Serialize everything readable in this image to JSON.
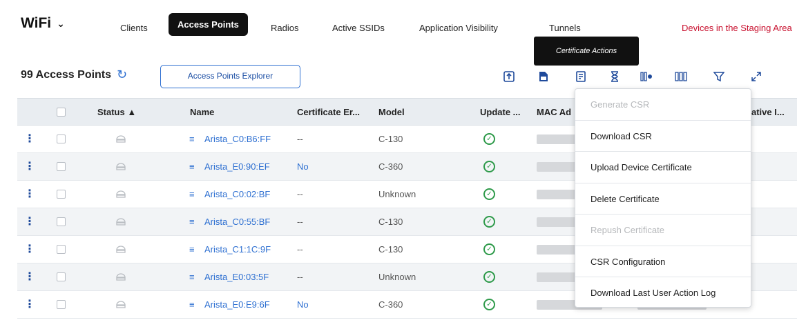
{
  "nav": {
    "app_title": "WiFi",
    "tabs": [
      {
        "label": "Clients"
      },
      {
        "label": "Access Points",
        "active": true
      },
      {
        "label": "Radios"
      },
      {
        "label": "Active SSIDs"
      },
      {
        "label": "Application Visibility"
      },
      {
        "label": "Tunnels"
      }
    ],
    "staging_link": "Devices in the Staging Area"
  },
  "tooltip": "Certificate Actions",
  "toolbar": {
    "count_label": "99 Access Points",
    "explorer_button": "Access Points Explorer",
    "icons": [
      "upload-icon",
      "document-icon",
      "certificate-icon",
      "hourglass-icon",
      "column-settings-icon",
      "columns-icon",
      "filter-icon",
      "expand-icon"
    ]
  },
  "table": {
    "headers": {
      "status": "Status ▲",
      "name": "Name",
      "cert_error": "Certificate Er...",
      "model": "Model",
      "update": "Update ...",
      "mac": "MAC Ad",
      "native": "ative I..."
    },
    "rows": [
      {
        "name": "Arista_C0:B6:FF",
        "cert_error": "--",
        "model": "C-130"
      },
      {
        "name": "Arista_E0:90:EF",
        "cert_error": "No",
        "model": "C-360"
      },
      {
        "name": "Arista_C0:02:BF",
        "cert_error": "--",
        "model": "Unknown"
      },
      {
        "name": "Arista_C0:55:BF",
        "cert_error": "--",
        "model": "C-130"
      },
      {
        "name": "Arista_C1:1C:9F",
        "cert_error": "--",
        "model": "C-130"
      },
      {
        "name": "Arista_E0:03:5F",
        "cert_error": "--",
        "model": "Unknown"
      },
      {
        "name": "Arista_E0:E9:6F",
        "cert_error": "No",
        "model": "C-360",
        "trailing": "--"
      }
    ]
  },
  "menu": {
    "items": [
      {
        "label": "Generate CSR",
        "disabled": true
      },
      {
        "label": "Download CSR",
        "disabled": false
      },
      {
        "label": "Upload Device Certificate",
        "disabled": false
      },
      {
        "label": "Delete Certificate",
        "disabled": false
      },
      {
        "label": "Repush Certificate",
        "disabled": true
      },
      {
        "label": "CSR Configuration",
        "disabled": false
      },
      {
        "label": "Download Last User Action Log",
        "disabled": false
      }
    ]
  },
  "colors": {
    "accent": "#2d6fd1",
    "active_tab": "#111111",
    "staging_link": "#c8102e",
    "header_bg": "#e9edf1",
    "status_ok": "#2e9a4a"
  }
}
